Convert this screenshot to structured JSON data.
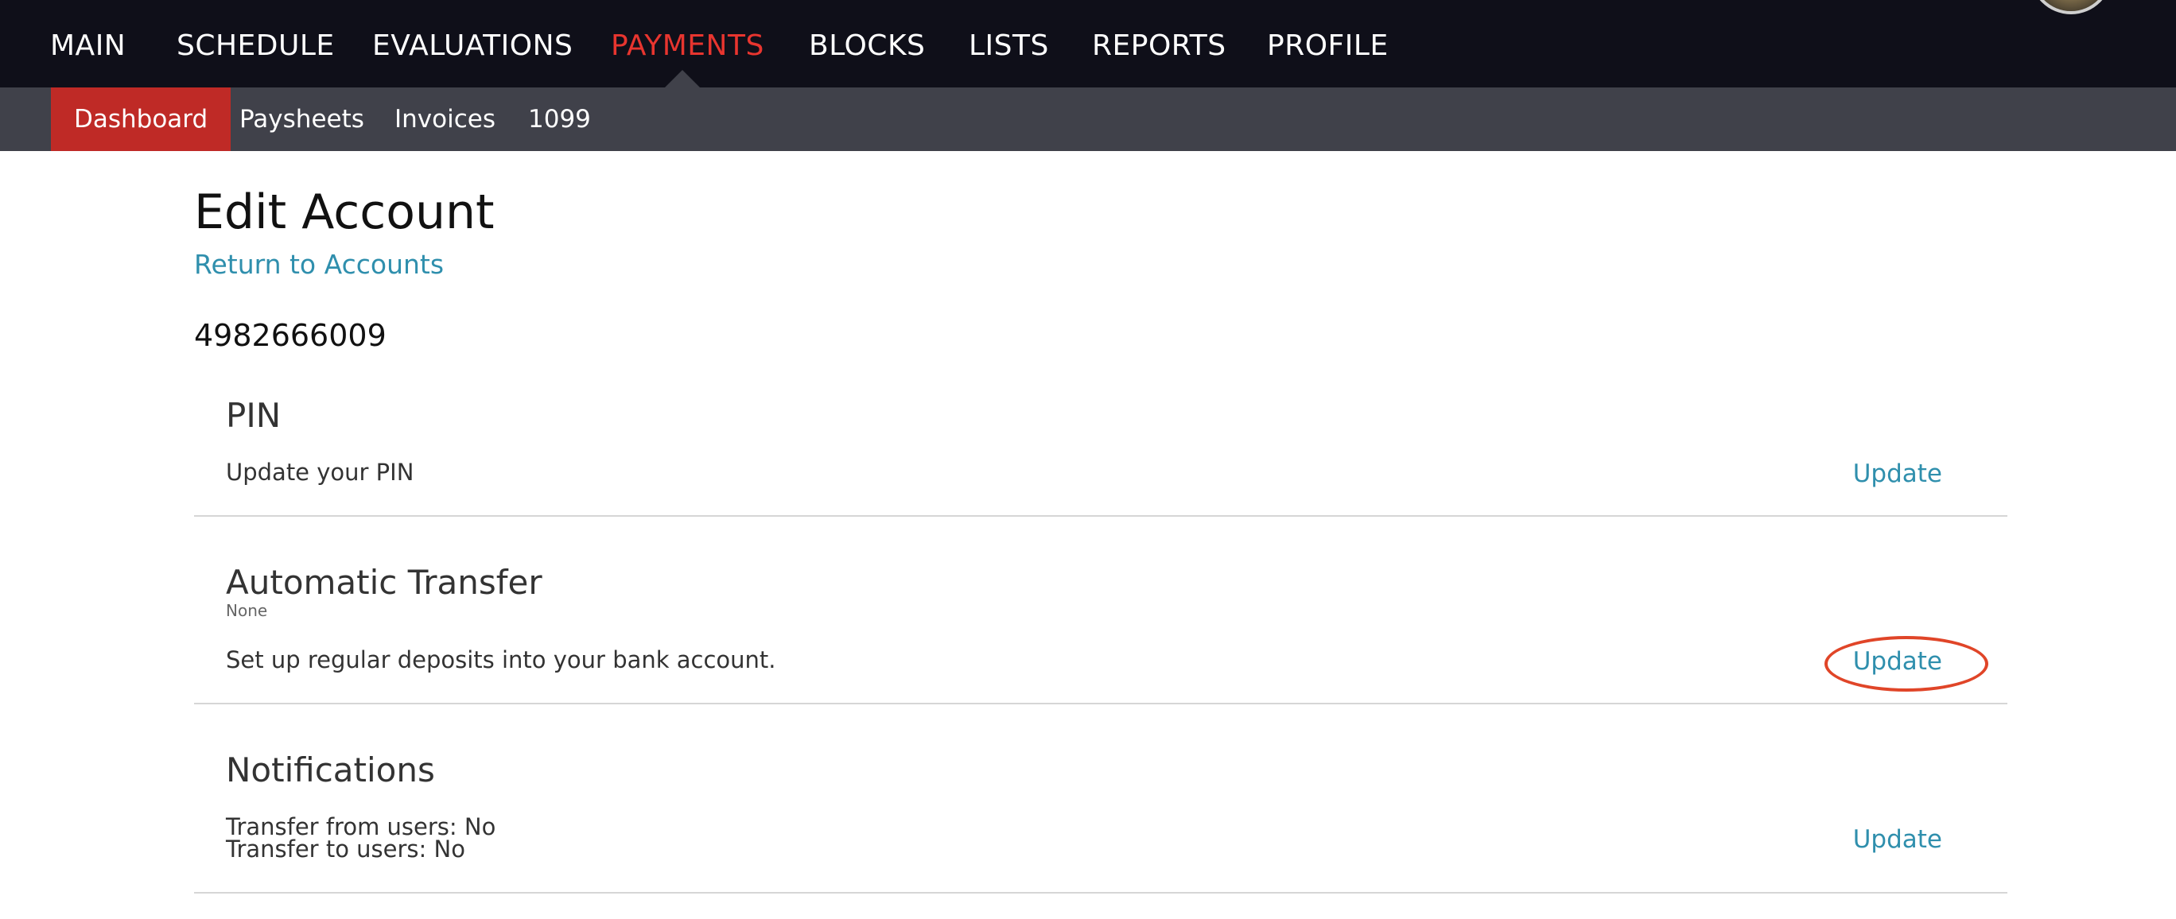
{
  "topnav": {
    "items": [
      "MAIN",
      "SCHEDULE",
      "EVALUATIONS",
      "PAYMENTS",
      "BLOCKS",
      "LISTS",
      "REPORTS",
      "PROFILE"
    ],
    "active": "PAYMENTS"
  },
  "subnav": {
    "items": [
      "Dashboard",
      "Paysheets",
      "Invoices",
      "1099"
    ],
    "active": "Dashboard"
  },
  "page": {
    "title": "Edit Account",
    "return_link": "Return to Accounts",
    "account_number": "4982666009"
  },
  "sections": {
    "pin": {
      "title": "PIN",
      "description": "Update your PIN",
      "update_label": "Update"
    },
    "automatic_transfer": {
      "title": "Automatic Transfer",
      "status": "None",
      "description": "Set up regular deposits into your bank account.",
      "update_label": "Update"
    },
    "notifications": {
      "title": "Notifications",
      "line1": "Transfer from users: No",
      "line2": "Transfer to users: No",
      "update_label": "Update"
    }
  },
  "colors": {
    "topnav_bg": "#0f0f19",
    "subnav_bg": "#40414a",
    "active_red": "#e8352f",
    "active_tab_bg": "#bf2a26",
    "link_blue": "#2f8fad",
    "annotation_red": "#e04528"
  }
}
